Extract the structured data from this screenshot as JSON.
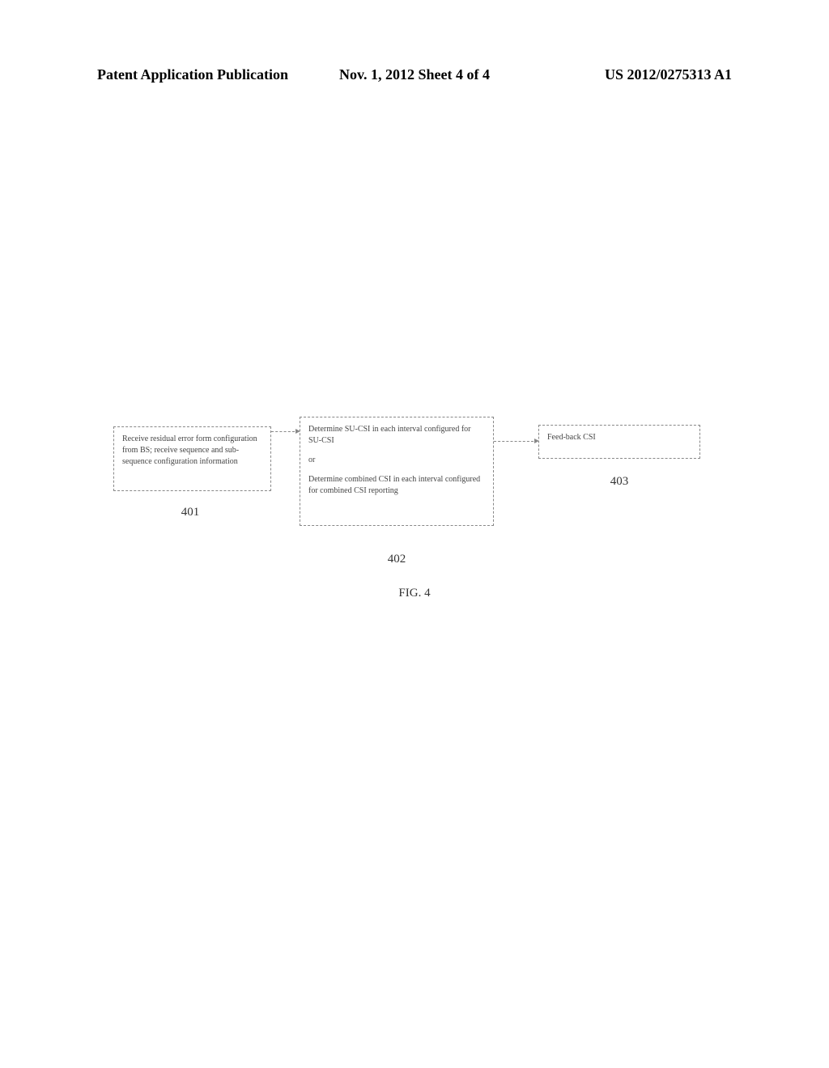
{
  "header": {
    "left": "Patent Application Publication",
    "mid": "Nov. 1, 2012   Sheet 4 of 4",
    "right": "US 2012/0275313 A1"
  },
  "boxes": {
    "box1": "Receive residual error form configuration from BS; receive sequence and sub-sequence configuration information",
    "box2a": "Determine SU-CSI in each interval configured for SU-CSI",
    "box2or": "or",
    "box2b": "Determine combined CSI in each interval configured for combined CSI reporting",
    "box3": "Feed-back  CSI"
  },
  "labels": {
    "l1": "401",
    "l2": "402",
    "l3": "403"
  },
  "caption": "FIG. 4"
}
